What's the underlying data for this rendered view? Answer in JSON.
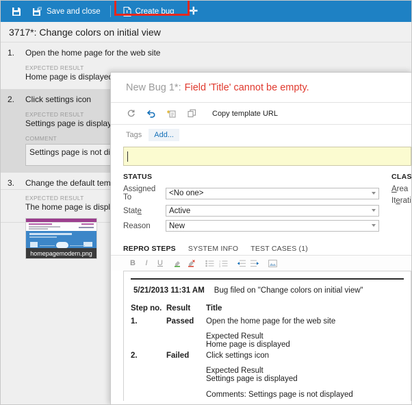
{
  "toolbar": {
    "save_icon": "save-icon",
    "save_and_close": "Save and close",
    "create_bug": "Create bug",
    "plus": "✦"
  },
  "page_title": "3717*: Change colors on initial view",
  "steps": [
    {
      "number": "1.",
      "title": "Open the home page for the web site",
      "expected_label": "EXPECTED RESULT",
      "expected_value": "Home page is displayed",
      "selected": false
    },
    {
      "number": "2.",
      "title": "Click settings icon",
      "expected_label": "EXPECTED RESULT",
      "expected_value": "Settings page is displayed",
      "comment_label": "COMMENT",
      "comment_value": "Settings page is not displ",
      "selected": true
    },
    {
      "number": "3.",
      "title": "Change the default templ",
      "expected_label": "EXPECTED RESULT",
      "expected_value": "The home page is display",
      "attachment": "homepagemodern.png",
      "selected": false
    }
  ],
  "dialog": {
    "title": "New Bug 1*:",
    "error": "Field 'Title' cannot be empty.",
    "tools": {
      "refresh": "refresh-icon",
      "undo": "undo-icon",
      "revert": "revert-icon",
      "copy": "copy-icon",
      "copy_template_url": "Copy template URL"
    },
    "tags": {
      "label": "Tags",
      "add": "Add..."
    },
    "title_field_value": "",
    "status": {
      "section": "STATUS",
      "fields": [
        {
          "label": "Assigned To",
          "value": "<No one>"
        },
        {
          "label": "State",
          "value": "Active"
        },
        {
          "label": "Reason",
          "value": "New"
        }
      ]
    },
    "classification": {
      "section": "CLASS",
      "fields": [
        {
          "label": "Area"
        },
        {
          "label": "Iterati"
        }
      ]
    },
    "tabs": [
      {
        "label": "REPRO STEPS",
        "active": true
      },
      {
        "label": "SYSTEM INFO",
        "active": false
      },
      {
        "label": "TEST CASES (1)",
        "active": false
      }
    ],
    "format_tools": [
      "B",
      "I",
      "U",
      "highlight-icon",
      "clear-format-icon",
      "bullet-list-icon",
      "numbered-list-icon",
      "outdent-icon",
      "indent-icon",
      "image-icon"
    ],
    "repro": {
      "filed_date": "5/21/2013 11:31 AM",
      "filed_text": "Bug filed on \"Change colors on initial view\"",
      "columns": [
        "Step no.",
        "Result",
        "Title"
      ],
      "rows": [
        {
          "step": "1.",
          "result": "Passed",
          "result_state": "pass",
          "title": "Open the home page for the web site",
          "expected_label": "Expected Result",
          "expected_value": "Home page is displayed",
          "comment": ""
        },
        {
          "step": "2.",
          "result": "Failed",
          "result_state": "fail",
          "title": "Click settings icon",
          "expected_label": "Expected Result",
          "expected_value": "Settings page is displayed",
          "comment": "Comments: Settings page is not displayed"
        }
      ]
    }
  },
  "colors": {
    "toolbar_blue": "#1e81c4",
    "highlight_red": "#e8281e",
    "error_red": "#e03a2f",
    "pass_green": "#1a8a1a",
    "fail_red": "#e02020",
    "title_field_yellow": "#fbfbd0"
  }
}
